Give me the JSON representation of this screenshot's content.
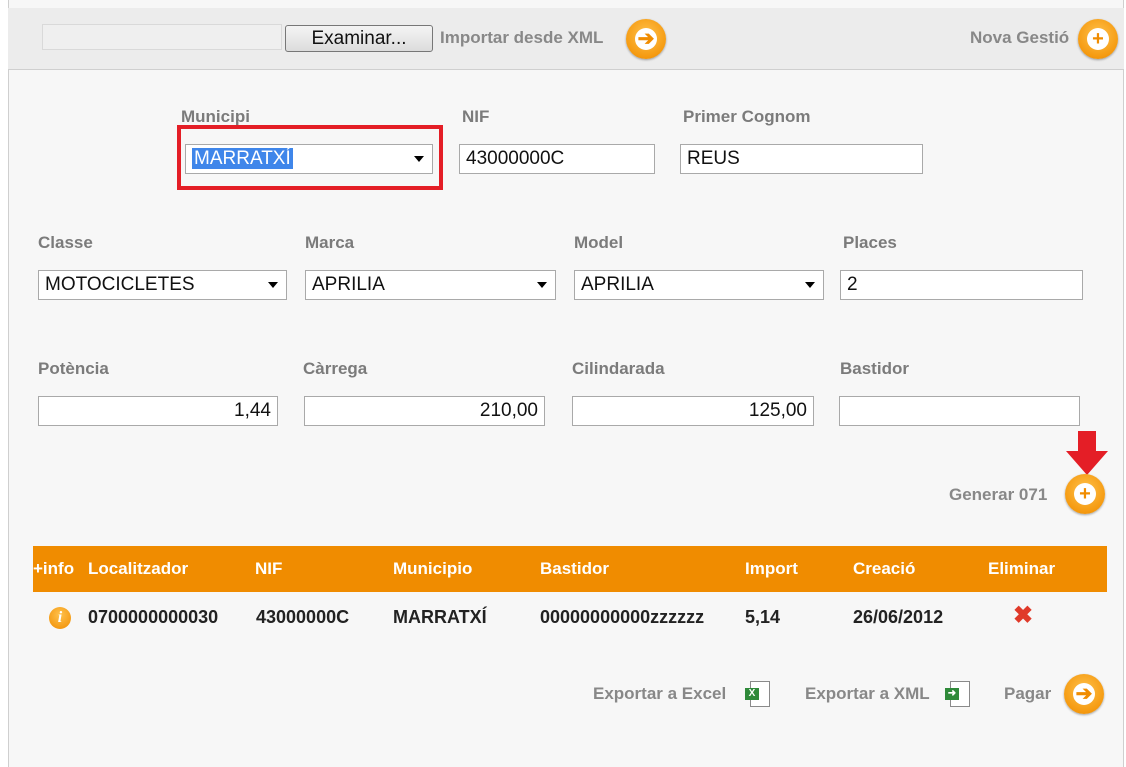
{
  "toolbar": {
    "browse_label": "Examinar...",
    "import_label": "Importar desde XML",
    "new_label": "Nova Gestió"
  },
  "form": {
    "municipi": {
      "label": "Municipi",
      "value": "MARRATXÍ"
    },
    "nif": {
      "label": "NIF",
      "value": "43000000C"
    },
    "primer_cognom": {
      "label": "Primer Cognom",
      "value": "REUS"
    },
    "classe": {
      "label": "Classe",
      "value": "MOTOCICLETES"
    },
    "marca": {
      "label": "Marca",
      "value": "APRILIA"
    },
    "model": {
      "label": "Model",
      "value": "APRILIA"
    },
    "places": {
      "label": "Places",
      "value": "2"
    },
    "potencia": {
      "label": "Potència",
      "value": "1,44"
    },
    "carrega": {
      "label": "Càrrega",
      "value": "210,00"
    },
    "cilindrada": {
      "label": "Cilindarada",
      "value": "125,00"
    },
    "bastidor": {
      "label": "Bastidor",
      "value": ""
    }
  },
  "generate_label": "Generar 071",
  "table": {
    "headers": [
      "+info",
      "Localitzador",
      "NIF",
      "Municipio",
      "Bastidor",
      "Import",
      "Creació",
      "Eliminar"
    ],
    "rows": [
      {
        "localitzador": "0700000000030",
        "nif": "43000000C",
        "municipio": "MARRATXÍ",
        "bastidor": "00000000000zzzzzz",
        "import": "5,14",
        "creacio": "26/06/2012"
      }
    ]
  },
  "footer": {
    "export_excel": "Exportar a Excel",
    "export_xml": "Exportar a XML",
    "pay": "Pagar"
  },
  "colors": {
    "accent": "#f08c00",
    "highlight": "#e41e26",
    "selection": "#3f86ea"
  },
  "icons": [
    "arrow-right-circle-icon",
    "plus-circle-icon",
    "info-icon",
    "delete-x-icon",
    "excel-file-icon",
    "xml-file-icon",
    "down-arrow-icon"
  ]
}
